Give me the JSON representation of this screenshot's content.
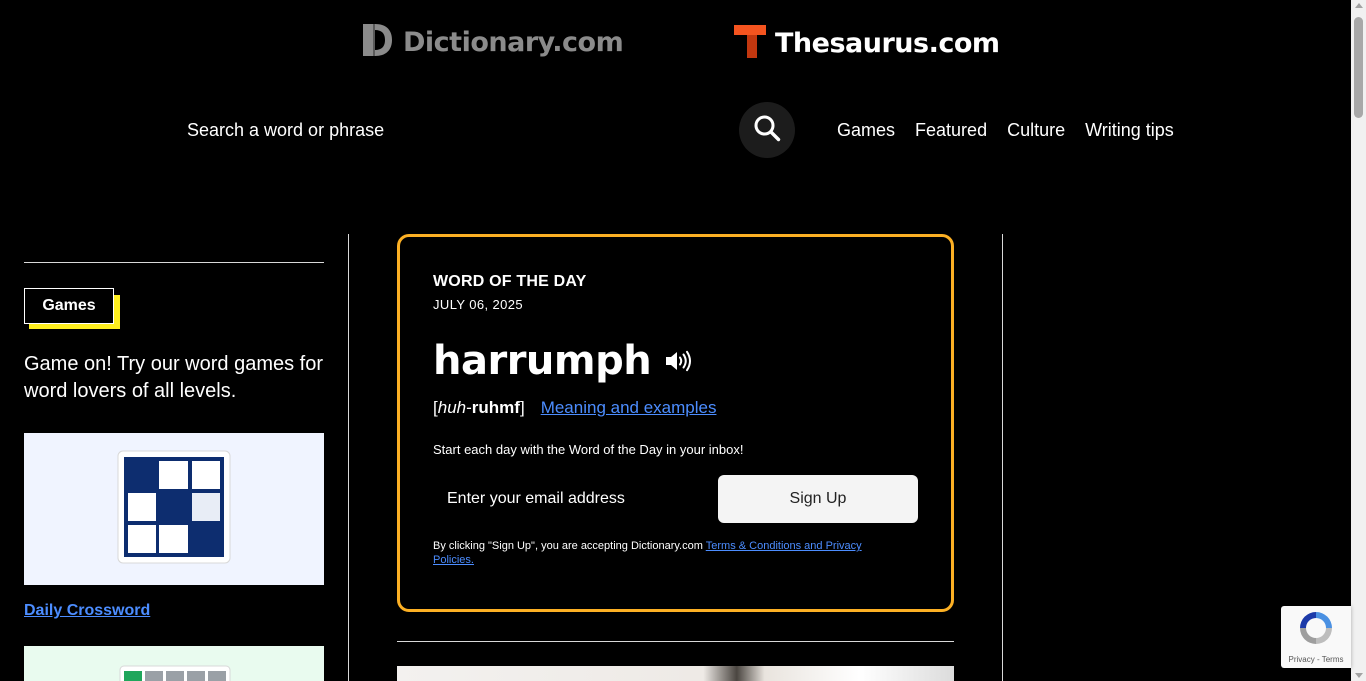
{
  "header": {
    "dictionary_brand": "Dictionary.com",
    "thesaurus_brand": "Thesaurus.com",
    "search_placeholder": "Search a word or phrase",
    "nav": [
      "Games",
      "Featured",
      "Culture",
      "Writing tips"
    ]
  },
  "sidebar": {
    "games_tag": "Games",
    "games_desc": "Game on! Try our word games for word lovers of all levels.",
    "crossword_link": "Daily Crossword"
  },
  "wotd": {
    "heading": "WORD OF THE DAY",
    "date": "JULY 06, 2025",
    "word": "harrumph",
    "pron_open": "[",
    "pron_italic": "huh",
    "pron_sep": "-",
    "pron_bold": "ruhmf",
    "pron_close": "]",
    "meaning_link": "Meaning and examples",
    "cta": "Start each day with the Word of the Day in your inbox!",
    "email_placeholder": "Enter your email address",
    "signup_label": "Sign Up",
    "legal_text": "By clicking \"Sign Up\", you are accepting Dictionary.com ",
    "legal_link": "Terms & Conditions and Privacy Policies."
  },
  "recaptcha": {
    "text": "Privacy - Terms"
  },
  "colors": {
    "accent_yellow": "#fcb024",
    "games_highlight": "#ffef1e",
    "link_blue": "#4c8dff",
    "thesaurus_orange": "#f5541f"
  },
  "icons": [
    "dictionary-logo-icon",
    "thesaurus-logo-icon",
    "search-icon",
    "speaker-icon",
    "crossword-icon",
    "recaptcha-icon"
  ]
}
